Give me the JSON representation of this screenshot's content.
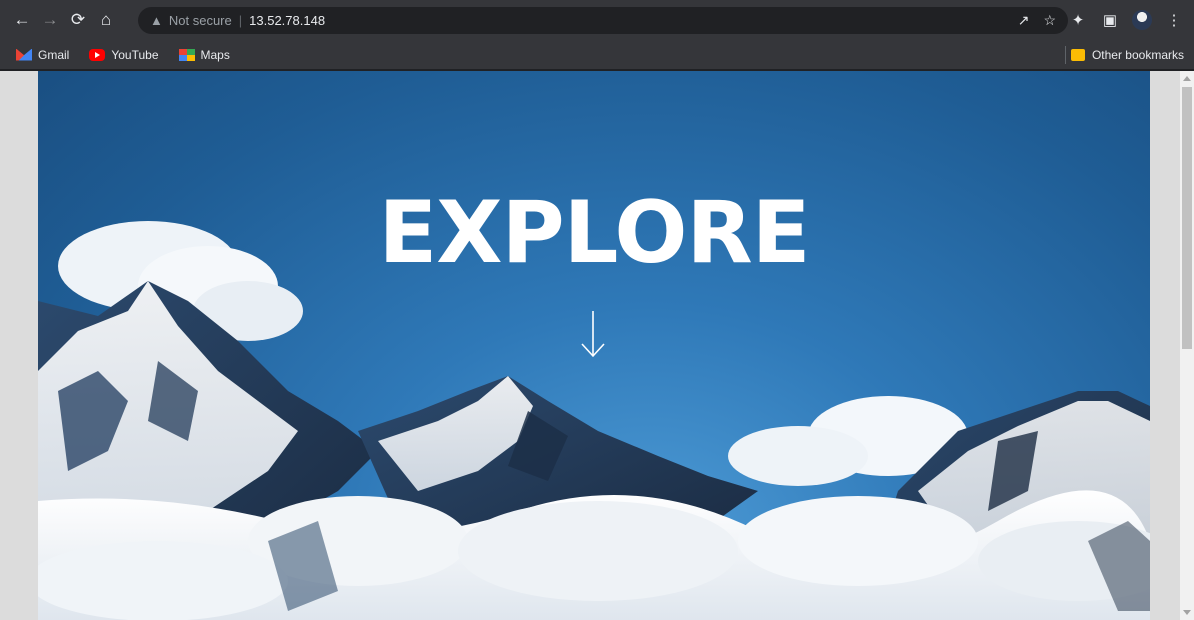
{
  "browser": {
    "omnibox": {
      "security_label": "Not secure",
      "url": "13.52.78.148"
    },
    "bookmarks": [
      {
        "label": "Gmail",
        "icon": "gmail-icon"
      },
      {
        "label": "YouTube",
        "icon": "youtube-icon"
      },
      {
        "label": "Maps",
        "icon": "maps-icon"
      }
    ],
    "other_bookmarks_label": "Other bookmarks"
  },
  "hero": {
    "title": "EXPLORE",
    "arrow_icon": "arrow-down-icon"
  },
  "colors": {
    "sky_dark": "#1a4f82",
    "sky_light": "#4d9bd6",
    "chrome_bg": "#35363a"
  }
}
